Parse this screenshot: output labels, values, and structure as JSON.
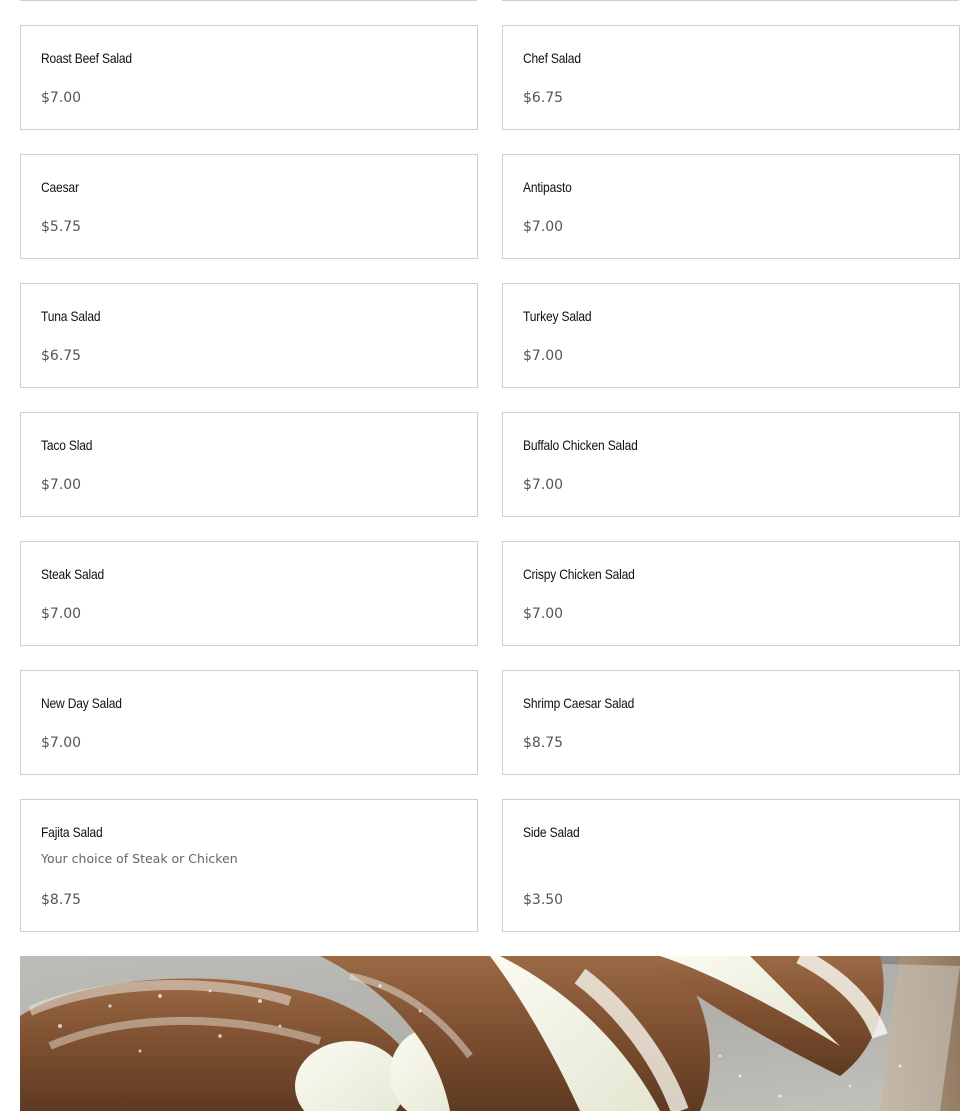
{
  "menu": {
    "rows": [
      [
        {
          "name": "Roast Beef Salad",
          "description": "",
          "price": "$7.00"
        },
        {
          "name": "Chef Salad",
          "description": "",
          "price": "$6.75"
        }
      ],
      [
        {
          "name": "Caesar",
          "description": "",
          "price": "$5.75"
        },
        {
          "name": "Antipasto",
          "description": "",
          "price": "$7.00"
        }
      ],
      [
        {
          "name": "Tuna Salad",
          "description": "",
          "price": "$6.75"
        },
        {
          "name": "Turkey Salad",
          "description": "",
          "price": "$7.00"
        }
      ],
      [
        {
          "name": "Taco Slad",
          "description": "",
          "price": "$7.00"
        },
        {
          "name": "Buffalo Chicken Salad",
          "description": "",
          "price": "$7.00"
        }
      ],
      [
        {
          "name": "Steak Salad",
          "description": "",
          "price": "$7.00"
        },
        {
          "name": "Crispy Chicken Salad",
          "description": "",
          "price": "$7.00"
        }
      ],
      [
        {
          "name": "New Day Salad",
          "description": "",
          "price": "$7.00"
        },
        {
          "name": "Shrimp Caesar Salad",
          "description": "",
          "price": "$8.75"
        }
      ],
      [
        {
          "name": "Fajita Salad",
          "description": "Your choice of Steak or Chicken",
          "price": "$8.75"
        },
        {
          "name": "Side Salad",
          "description": "",
          "price": "$3.50"
        }
      ]
    ]
  },
  "banner_image": {
    "subject": "cannoli-photo"
  }
}
